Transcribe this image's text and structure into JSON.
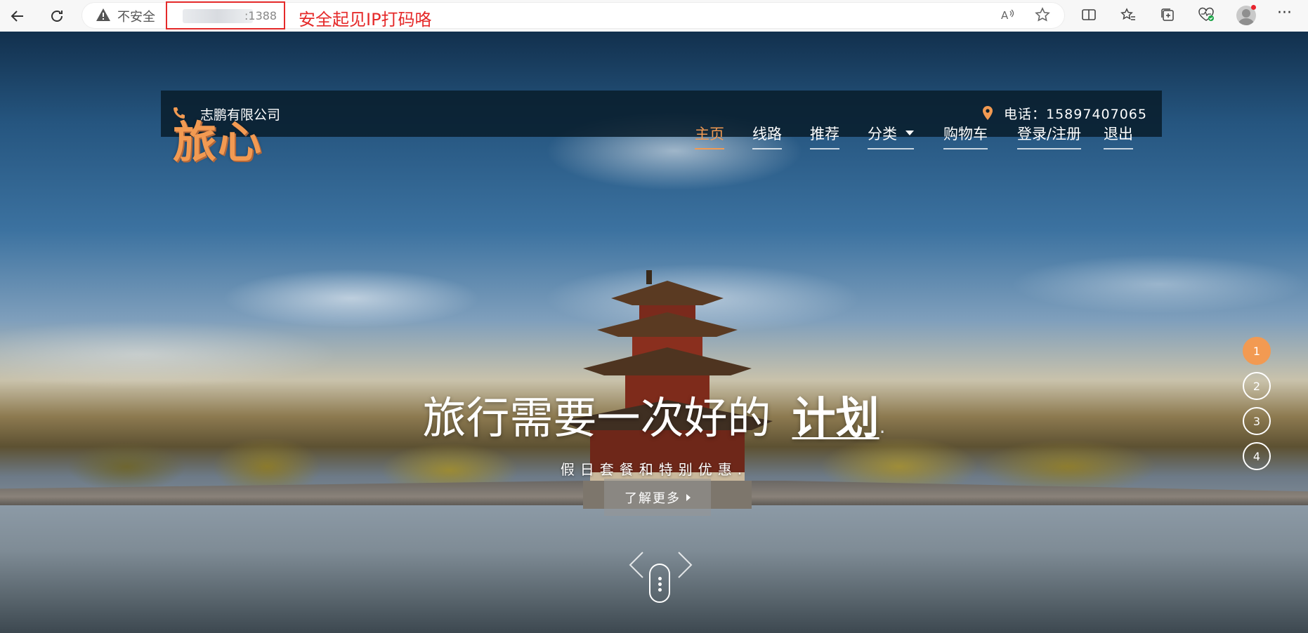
{
  "browser": {
    "security_label": "不安全",
    "url_port": ":1388",
    "annotation": "安全起见IP打码咯"
  },
  "topbar": {
    "company": "志鹏有限公司",
    "phone": "电话：15897407065"
  },
  "logo": "旅心",
  "nav": {
    "items": [
      {
        "label": "主页",
        "active": true
      },
      {
        "label": "线路"
      },
      {
        "label": "推荐"
      },
      {
        "label": "分类"
      },
      {
        "label": "购物车"
      },
      {
        "label": "登录/注册"
      },
      {
        "label": "退出"
      }
    ]
  },
  "hero": {
    "headline": "旅行需要一次好的",
    "headline_strong": "计划",
    "headline_dot": ".",
    "subline": "假日套餐和特别优惠.",
    "cta": "了解更多"
  },
  "slides": [
    "1",
    "2",
    "3",
    "4"
  ],
  "colors": {
    "accent": "#f29a52",
    "annotation_red": "#e52a2a",
    "topbar_bg": "#081c2a"
  }
}
